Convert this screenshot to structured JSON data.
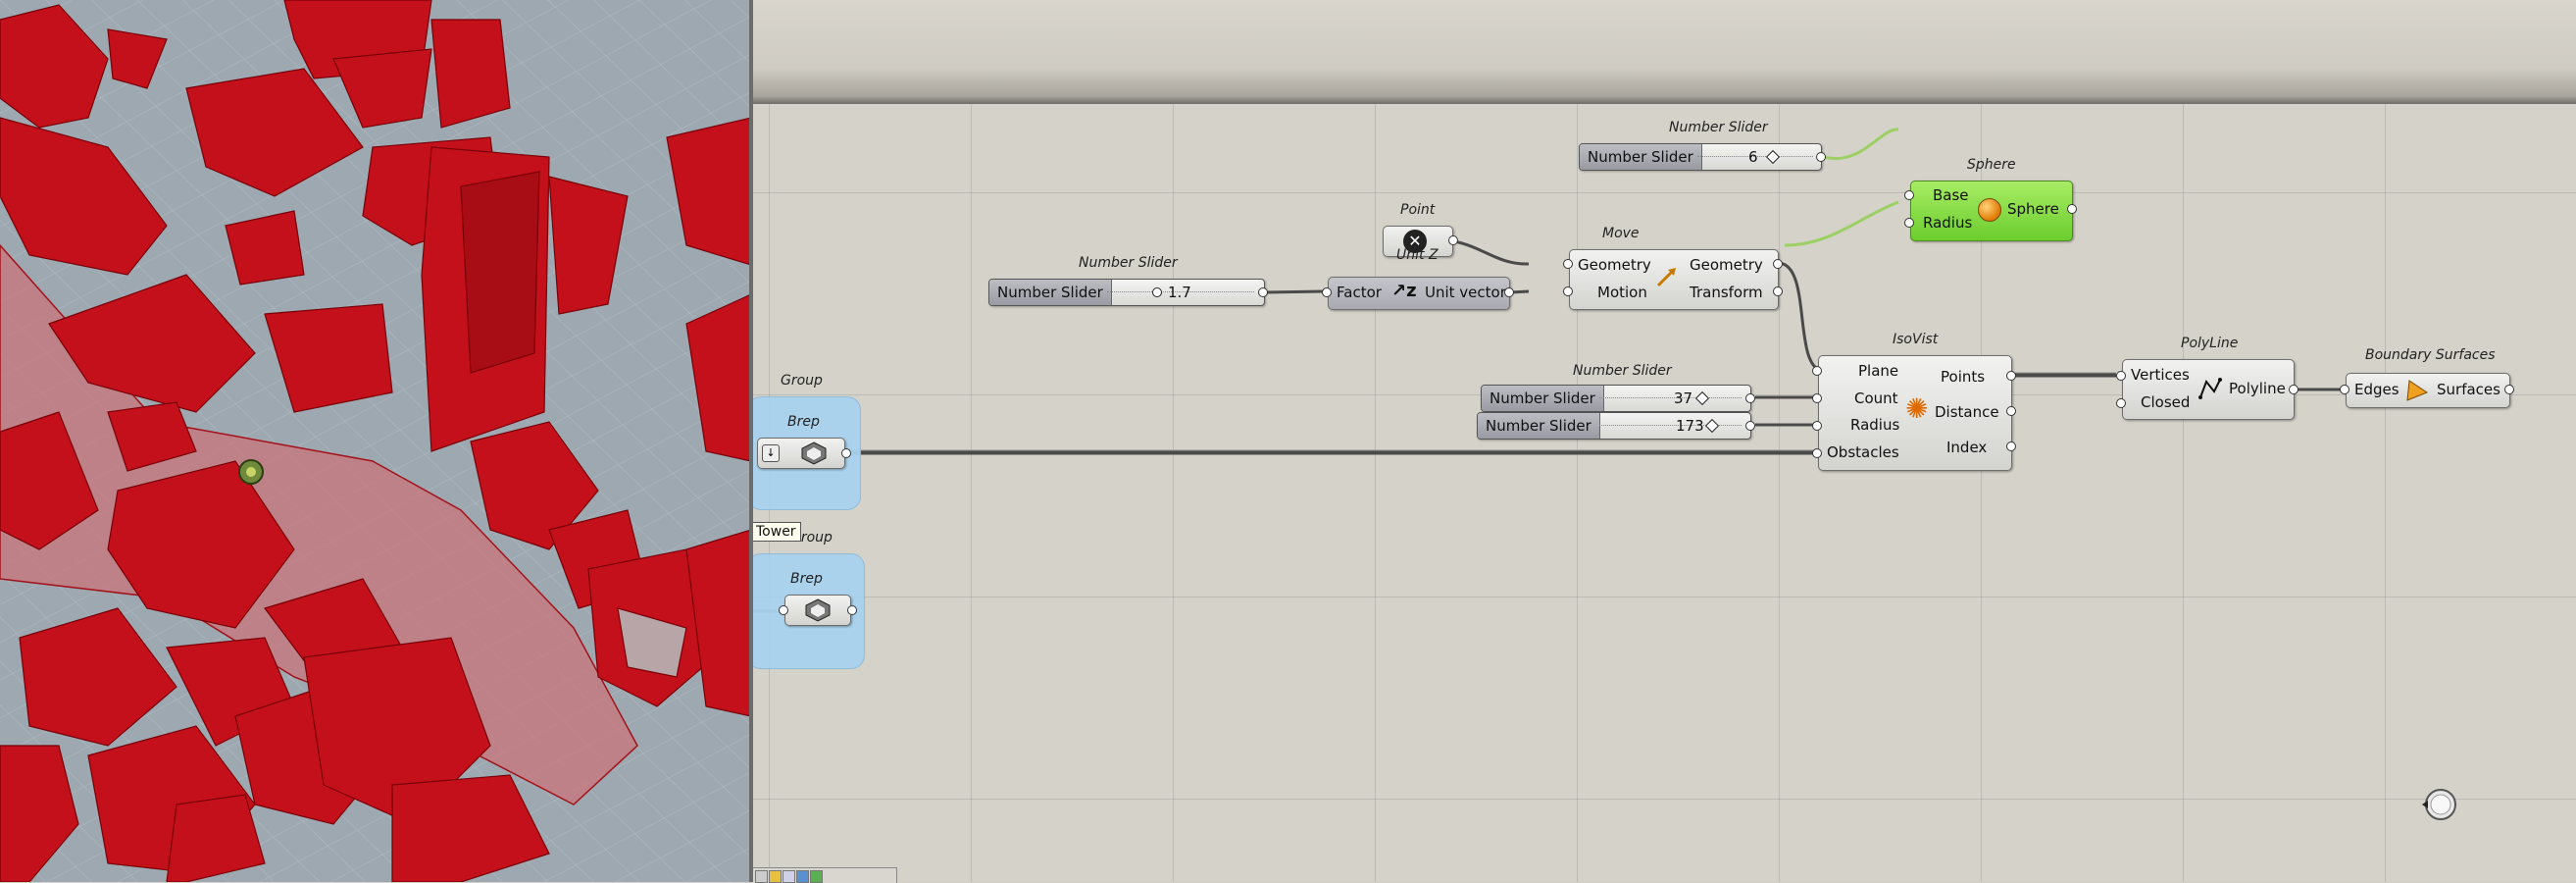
{
  "canvas": {
    "groups": [
      {
        "title": "Group",
        "param_title": "Brep"
      },
      {
        "title": "Group",
        "param_title": "Brep"
      }
    ],
    "tooltip": "Tower",
    "sliders": {
      "s6": {
        "title": "Number Slider",
        "name": "Number Slider",
        "value": "6"
      },
      "s17": {
        "title": "Number Slider",
        "name": "Number Slider",
        "value": "1.7"
      },
      "s37": {
        "title": "Number Slider",
        "name": "Number Slider",
        "value": "37"
      },
      "s173": {
        "name": "Number Slider",
        "value": "173"
      }
    },
    "point": {
      "title": "Point"
    },
    "unitz": {
      "title": "Unit Z",
      "input": "Factor",
      "output": "Unit vector"
    },
    "move": {
      "title": "Move",
      "inputs": [
        "Geometry",
        "Motion"
      ],
      "outputs": [
        "Geometry",
        "Transform"
      ]
    },
    "sphere": {
      "title": "Sphere",
      "inputs": [
        "Base",
        "Radius"
      ],
      "output": "Sphere"
    },
    "isovist": {
      "title": "IsoVist",
      "inputs": [
        "Plane",
        "Count",
        "Radius",
        "Obstacles"
      ],
      "outputs": [
        "Points",
        "Distance",
        "Index"
      ]
    },
    "polyline": {
      "title": "PolyLine",
      "inputs": [
        "Vertices",
        "Closed"
      ],
      "output": "Polyline"
    },
    "boundary": {
      "title": "Boundary Surfaces",
      "input": "Edges",
      "output": "Surfaces"
    }
  },
  "colors": {
    "building_red": "#c4101a",
    "canvas_bg": "#d5d2c9",
    "group_blue": "#a8d2ee",
    "sphere_green": "#7ed63a"
  }
}
